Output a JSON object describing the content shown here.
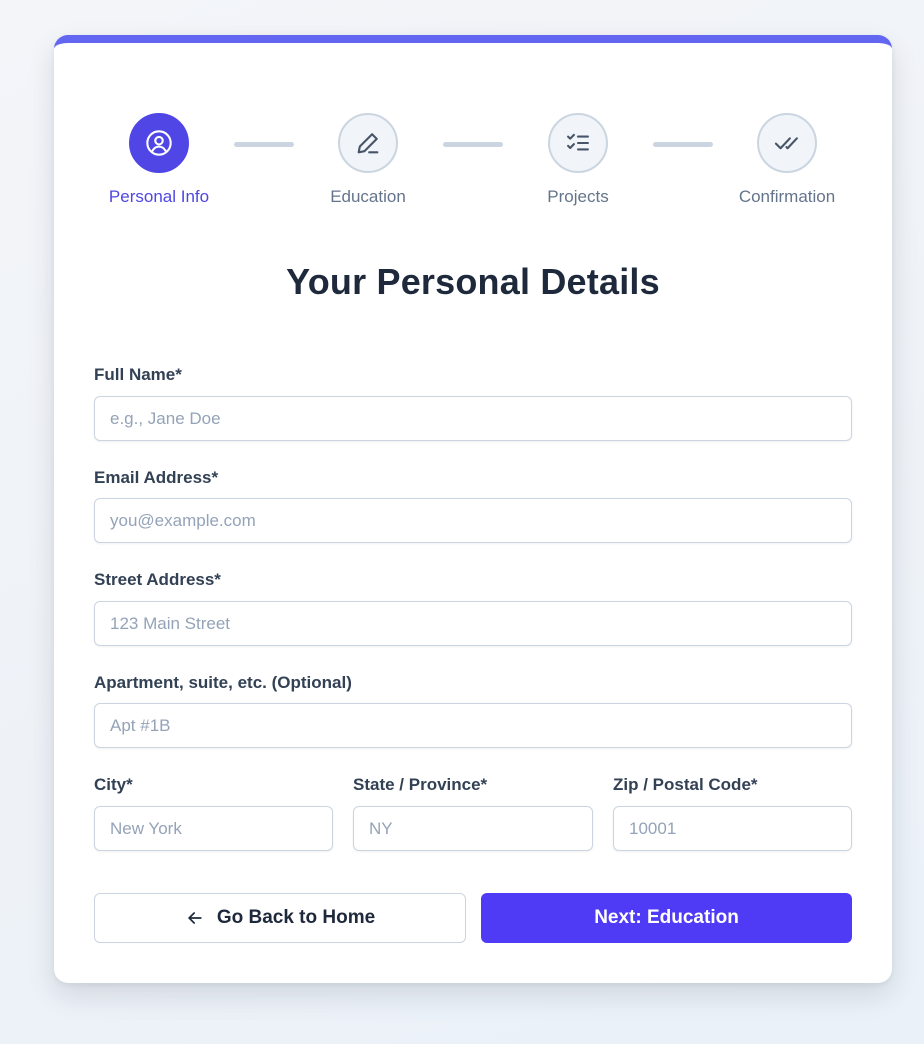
{
  "stepper": {
    "steps": [
      {
        "label": "Personal Info",
        "icon": "user-circle-icon",
        "active": true
      },
      {
        "label": "Education",
        "icon": "pencil-icon",
        "active": false
      },
      {
        "label": "Projects",
        "icon": "checklist-icon",
        "active": false
      },
      {
        "label": "Confirmation",
        "icon": "double-check-icon",
        "active": false
      }
    ]
  },
  "form": {
    "title": "Your Personal Details",
    "fields": {
      "full_name": {
        "label": "Full Name*",
        "placeholder": "e.g., Jane Doe",
        "value": ""
      },
      "email": {
        "label": "Email Address*",
        "placeholder": "you@example.com",
        "value": ""
      },
      "street": {
        "label": "Street Address*",
        "placeholder": "123 Main Street",
        "value": ""
      },
      "apartment": {
        "label": "Apartment, suite, etc. (Optional)",
        "placeholder": "Apt #1B",
        "value": ""
      },
      "city": {
        "label": "City*",
        "placeholder": "New York",
        "value": ""
      },
      "state": {
        "label": "State / Province*",
        "placeholder": "NY",
        "value": ""
      },
      "zip": {
        "label": "Zip / Postal Code*",
        "placeholder": "10001",
        "value": ""
      }
    }
  },
  "actions": {
    "back_label": "Go Back to Home",
    "next_label": "Next: Education"
  },
  "colors": {
    "accent": "#4f46e5",
    "top_border": "#6366f1",
    "primary_button": "#4f3bf5",
    "inactive": "#64748b"
  }
}
